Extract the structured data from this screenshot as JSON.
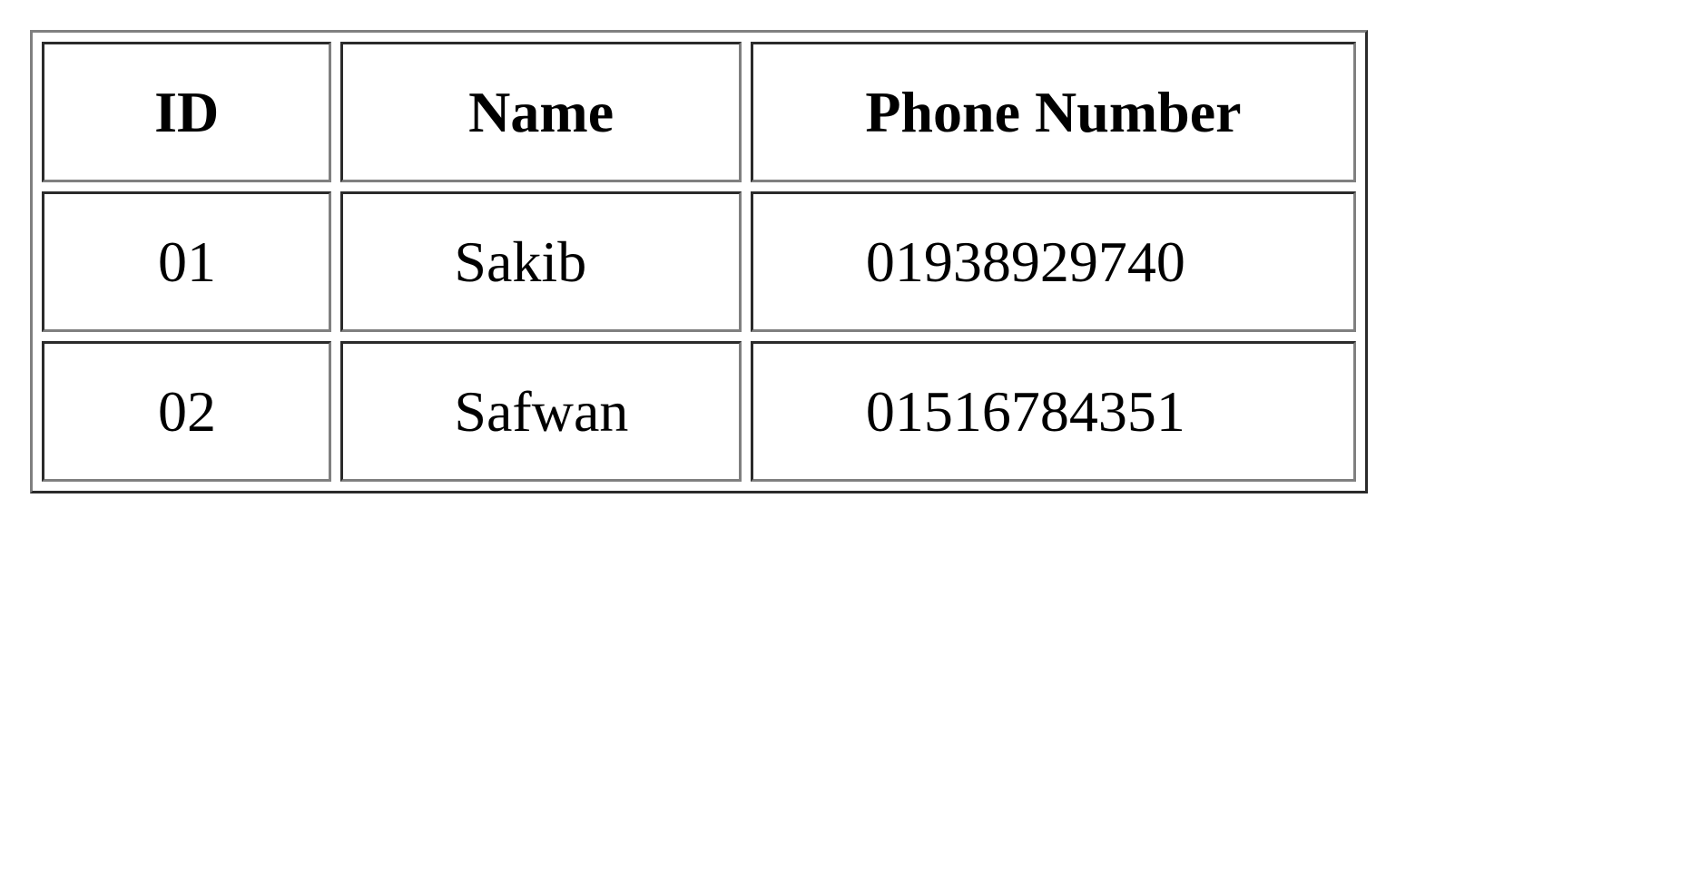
{
  "table": {
    "headers": [
      "ID",
      "Name",
      "Phone Number"
    ],
    "rows": [
      [
        "01",
        "Sakib",
        "01938929740"
      ],
      [
        "02",
        "Safwan",
        "01516784351"
      ]
    ]
  }
}
